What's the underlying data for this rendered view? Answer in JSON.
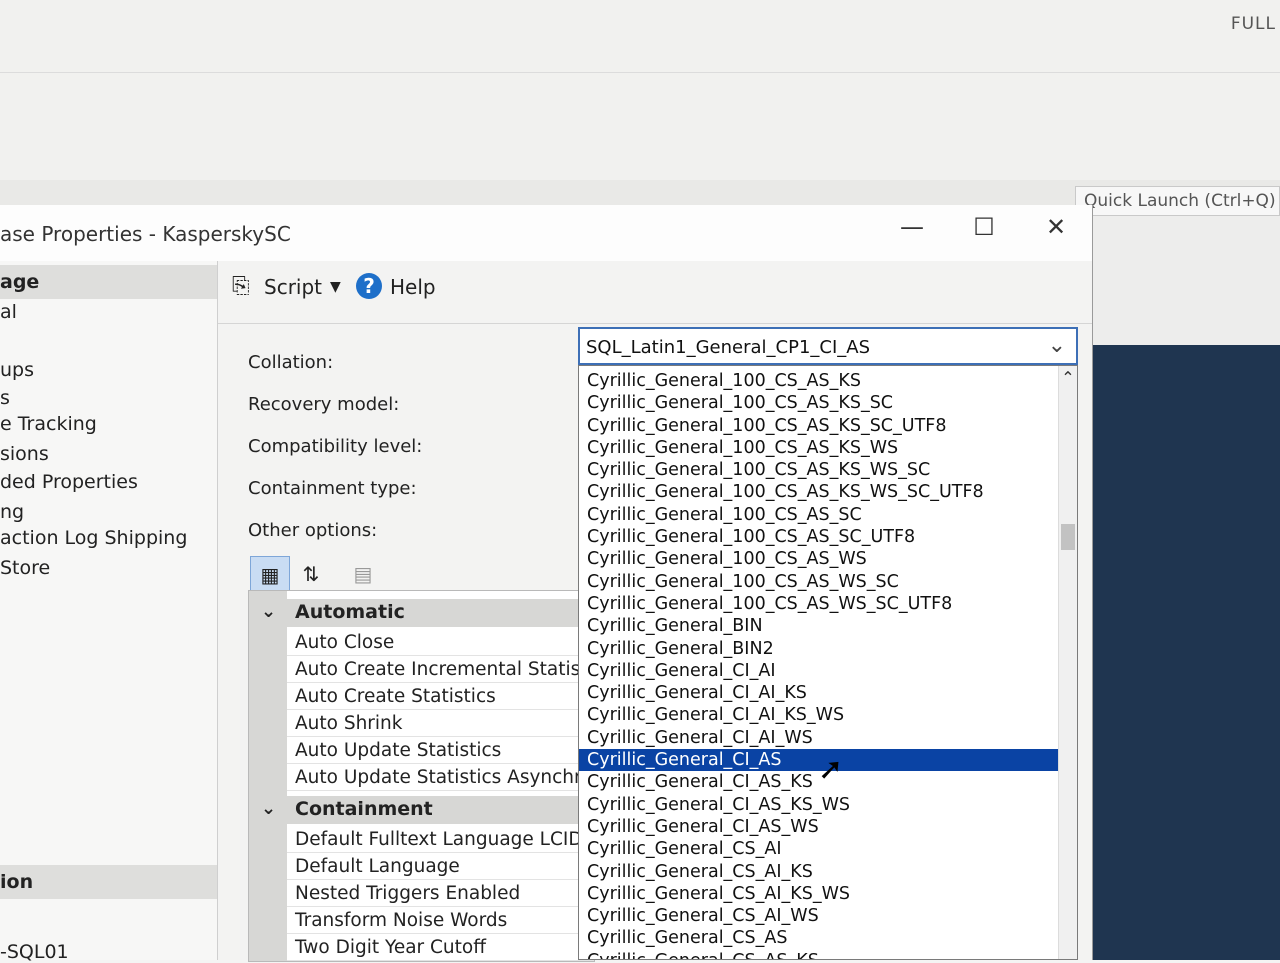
{
  "background": {
    "top_right_label": "FULL",
    "quick_launch_placeholder": "Quick Launch (Ctrl+Q)"
  },
  "window": {
    "title": "ase Properties - KasperskySC",
    "minimize": "—",
    "maximize": "☐",
    "close": "✕"
  },
  "left_panel": {
    "header": "age",
    "items": [
      "al",
      "ups",
      "s",
      "e Tracking",
      "sions",
      "ded Properties",
      "ng",
      "action Log Shipping",
      " Store"
    ],
    "section2_header": "ion",
    "section2_value": "-SQL01"
  },
  "toolbar": {
    "script_label": "Script",
    "script_dropdown": "▼",
    "help_label": "Help"
  },
  "form": {
    "collation_label": "Collation:",
    "recovery_model_label": "Recovery model:",
    "compatibility_level_label": "Compatibility level:",
    "containment_type_label": "Containment type:",
    "other_options_label": "Other options:"
  },
  "property_grid": {
    "categories": [
      {
        "name": "Automatic",
        "properties": [
          "Auto Close",
          "Auto Create Incremental Statistics",
          "Auto Create Statistics",
          "Auto Shrink",
          "Auto Update Statistics",
          "Auto Update Statistics Asynchrono"
        ]
      },
      {
        "name": "Containment",
        "properties": [
          "Default Fulltext Language LCID",
          "Default Language",
          "Nested Triggers Enabled",
          "Transform Noise Words",
          "Two Digit Year Cutoff"
        ]
      }
    ]
  },
  "collation_combo": {
    "value": "SQL_Latin1_General_CP1_CI_AS",
    "options": [
      "Cyrillic_General_100_CS_AS_KS",
      "Cyrillic_General_100_CS_AS_KS_SC",
      "Cyrillic_General_100_CS_AS_KS_SC_UTF8",
      "Cyrillic_General_100_CS_AS_KS_WS",
      "Cyrillic_General_100_CS_AS_KS_WS_SC",
      "Cyrillic_General_100_CS_AS_KS_WS_SC_UTF8",
      "Cyrillic_General_100_CS_AS_SC",
      "Cyrillic_General_100_CS_AS_SC_UTF8",
      "Cyrillic_General_100_CS_AS_WS",
      "Cyrillic_General_100_CS_AS_WS_SC",
      "Cyrillic_General_100_CS_AS_WS_SC_UTF8",
      "Cyrillic_General_BIN",
      "Cyrillic_General_BIN2",
      "Cyrillic_General_CI_AI",
      "Cyrillic_General_CI_AI_KS",
      "Cyrillic_General_CI_AI_KS_WS",
      "Cyrillic_General_CI_AI_WS",
      "Cyrillic_General_CI_AS",
      "Cyrillic_General_CI_AS_KS",
      "Cyrillic_General_CI_AS_KS_WS",
      "Cyrillic_General_CI_AS_WS",
      "Cyrillic_General_CS_AI",
      "Cyrillic_General_CS_AI_KS",
      "Cyrillic_General_CS_AI_KS_WS",
      "Cyrillic_General_CS_AI_WS",
      "Cyrillic_General_CS_AS",
      "Cyrillic_General_CS_AS_KS"
    ],
    "highlighted": "Cyrillic_General_CI_AS"
  },
  "colors": {
    "selection": "#0a43a4",
    "combo_border": "#3d6fb6",
    "dark_background": "#1f3550"
  }
}
